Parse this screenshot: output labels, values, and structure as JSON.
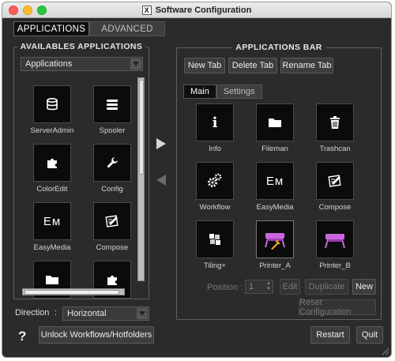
{
  "window": {
    "title": "Software Configuration"
  },
  "top_tabs": [
    {
      "label": "APPLICATIONS",
      "active": true
    },
    {
      "label": "ADVANCED",
      "active": false
    }
  ],
  "available": {
    "title": "AVAILABLES APPLICATIONS",
    "filter_value": "Applications",
    "apps": [
      {
        "label": "ServerAdmin",
        "icon": "database-icon"
      },
      {
        "label": "Spooler",
        "icon": "stack-icon"
      },
      {
        "label": "ColorEdit",
        "icon": "puzzle-icon"
      },
      {
        "label": "Config",
        "icon": "wrench-icon"
      },
      {
        "label": "EasyMedia",
        "icon": "em-logo-icon"
      },
      {
        "label": "Compose",
        "icon": "compose-icon"
      },
      {
        "label": "",
        "icon": "folder-icon"
      },
      {
        "label": "",
        "icon": "puzzle-icon"
      }
    ]
  },
  "bar": {
    "title": "APPLICATIONS BAR",
    "buttons": {
      "new_tab": "New Tab",
      "delete_tab": "Delete Tab",
      "rename_tab": "Rename Tab"
    },
    "tabs": [
      {
        "label": "Main",
        "active": true
      },
      {
        "label": "Settings",
        "active": false
      }
    ],
    "apps": [
      {
        "label": "Info",
        "icon": "info-icon"
      },
      {
        "label": "Fileman",
        "icon": "folder-icon"
      },
      {
        "label": "Trashcan",
        "icon": "trash-icon"
      },
      {
        "label": "Workflow",
        "icon": "gears-icon"
      },
      {
        "label": "EasyMedia",
        "icon": "em-logo-icon"
      },
      {
        "label": "Compose",
        "icon": "compose-icon"
      },
      {
        "label": "Tiling+",
        "icon": "tiling-icon"
      },
      {
        "label": "Printer_A",
        "icon": "printer-icon"
      },
      {
        "label": "Printer_B",
        "icon": "printer-icon"
      }
    ],
    "position_label": "Position :",
    "position_value": "1",
    "edit_label": "Edit",
    "duplicate_label": "Duplicate",
    "new_label": "New",
    "reset_label": "Reset Configuration"
  },
  "direction": {
    "label": "Direction",
    "separator": ":",
    "value": "Horizontal"
  },
  "footer": {
    "help": "?",
    "unlock": "Unlock Workflows/Hotfolders",
    "restart": "Restart",
    "quit": "Quit"
  },
  "colors": {
    "printer_accent": "#c866e0",
    "cursor": "#f5a623",
    "window_bg": "#2b2b2b"
  }
}
